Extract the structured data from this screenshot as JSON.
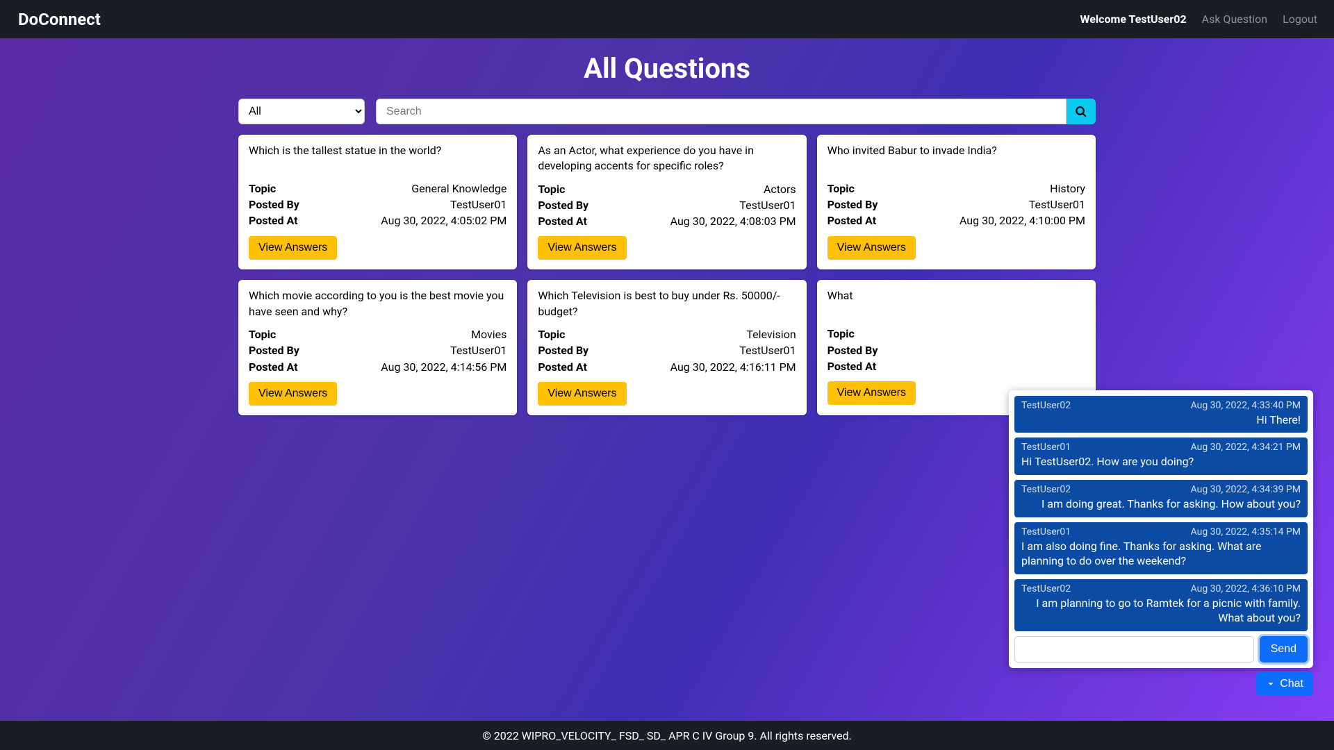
{
  "navbar": {
    "brand": "DoConnect",
    "welcome": "Welcome TestUser02",
    "ask": "Ask Question",
    "logout": "Logout"
  },
  "page": {
    "title": "All Questions"
  },
  "search": {
    "selected": "All",
    "placeholder": "Search"
  },
  "labels": {
    "topic": "Topic",
    "postedBy": "Posted By",
    "postedAt": "Posted At",
    "viewAnswers": "View Answers"
  },
  "questions": [
    {
      "title": "Which is the tallest statue in the world?",
      "topic": "General Knowledge",
      "postedBy": "TestUser01",
      "postedAt": "Aug 30, 2022, 4:05:02 PM"
    },
    {
      "title": "As an Actor, what experience do you have in developing accents for specific roles?",
      "topic": "Actors",
      "postedBy": "TestUser01",
      "postedAt": "Aug 30, 2022, 4:08:03 PM"
    },
    {
      "title": "Who invited Babur to invade India?",
      "topic": "History",
      "postedBy": "TestUser01",
      "postedAt": "Aug 30, 2022, 4:10:00 PM"
    },
    {
      "title": "Which movie according to you is the best movie you have seen and why?",
      "topic": "Movies",
      "postedBy": "TestUser01",
      "postedAt": "Aug 30, 2022, 4:14:56 PM"
    },
    {
      "title": "Which Television is best to buy under Rs. 50000/- budget?",
      "topic": "Television",
      "postedBy": "TestUser01",
      "postedAt": "Aug 30, 2022, 4:16:11 PM"
    },
    {
      "title": "What",
      "topic": "",
      "postedBy": "",
      "postedAt": ""
    }
  ],
  "chat": {
    "toggle": "Chat",
    "send": "Send",
    "messages": [
      {
        "user": "TestUser02",
        "time": "Aug 30, 2022, 4:33:40 PM",
        "body": "Hi There!",
        "self": true
      },
      {
        "user": "TestUser01",
        "time": "Aug 30, 2022, 4:34:21 PM",
        "body": "Hi TestUser02. How are you doing?",
        "self": false
      },
      {
        "user": "TestUser02",
        "time": "Aug 30, 2022, 4:34:39 PM",
        "body": "I am doing great. Thanks for asking. How about you?",
        "self": true
      },
      {
        "user": "TestUser01",
        "time": "Aug 30, 2022, 4:35:14 PM",
        "body": "I am also doing fine. Thanks for asking. What are planning to do over the weekend?",
        "self": false
      },
      {
        "user": "TestUser02",
        "time": "Aug 30, 2022, 4:36:10 PM",
        "body": "I am planning to go to Ramtek for a picnic with family. What about you?",
        "self": true
      }
    ]
  },
  "footer": {
    "text": "© 2022 WIPRO_VELOCITY_ FSD_ SD_ APR C IV Group 9. All rights reserved."
  }
}
